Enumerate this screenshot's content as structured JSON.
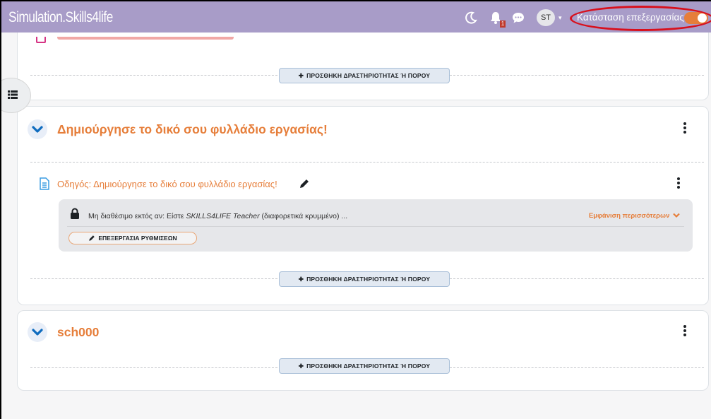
{
  "navbar": {
    "brand": "Simulation.Skills4life",
    "notification_count": "1",
    "avatar_initials": "ST",
    "edit_mode_label": "Κατάσταση επεξεργασίας"
  },
  "colors": {
    "navbar": "#a89cc8",
    "accent": "#e67e3a",
    "annotation": "#d8101d"
  },
  "sections": [
    {
      "add_label": "ΠΡΟΣΘΗΚΗ ΔΡΑΣΤΗΡΙΟΤΗΤΑΣ Ή ΠΟΡΟΥ"
    },
    {
      "title": "Δημιούργησε το δικό σου φυλλάδιο εργασίας!",
      "activity": {
        "name": "Οδηγός: Δημιούργησε το δικό σου φυλλάδιο εργασίας!",
        "restriction_prefix": "Μη διαθέσιμο εκτός αν: Είστε ",
        "restriction_role": "SKILLS4LIFE Teacher",
        "restriction_suffix": " (διαφορετικά κρυμμένο) ...",
        "show_more": "Εμφάνιση περισσότερων",
        "edit_settings": "ΕΠΕΞΕΡΓΑΣΙΑ ΡΥΘΜΙΣΕΩΝ"
      },
      "add_label": "ΠΡΟΣΘΗΚΗ ΔΡΑΣΤΗΡΙΟΤΗΤΑΣ Ή ΠΟΡΟΥ"
    },
    {
      "title": "sch000",
      "add_label": "ΠΡΟΣΘΗΚΗ ΔΡΑΣΤΗΡΙΟΤΗΤΑΣ Ή ΠΟΡΟΥ"
    }
  ],
  "icons": {
    "dark_mode": "moon-icon",
    "notifications": "bell-icon",
    "messages": "chat-icon",
    "drawer": "list-icon",
    "collapse": "chevron-down-icon",
    "menu": "kebab-icon",
    "page": "page-icon",
    "edit": "pencil-icon",
    "lock": "lock-icon",
    "add": "plus-icon"
  }
}
